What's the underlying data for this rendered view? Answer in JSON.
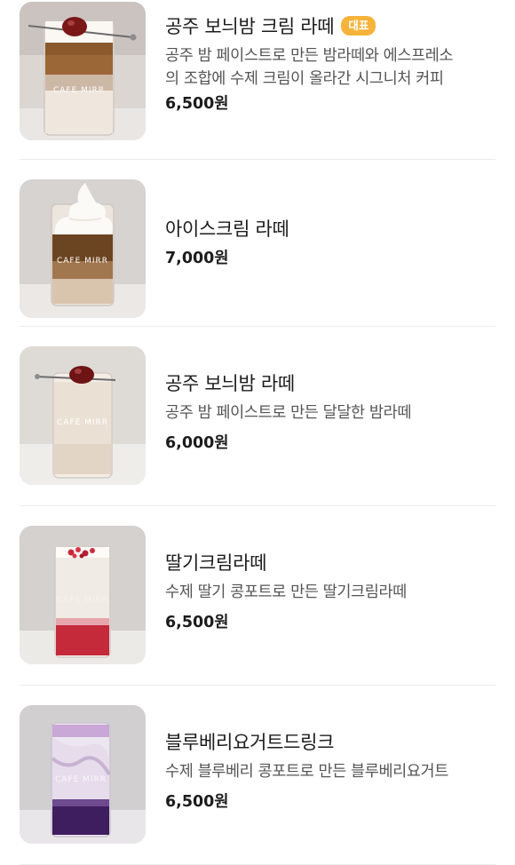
{
  "menu": {
    "items": [
      {
        "name": "공주 보늬밤 크림 라떼",
        "badge": "대표",
        "description_lines": [
          "공주 밤 페이스트로 만든 밤라떼와 에스프레소",
          "의 조합에 수제 크림이 올라간 시그니처 커피"
        ],
        "price": "6,500원",
        "image_icon": "chestnut-cream-latte-photo"
      },
      {
        "name": "아이스크림 라떼",
        "badge": "",
        "description_lines": [],
        "price": "7,000원",
        "image_icon": "icecream-latte-photo"
      },
      {
        "name": "공주 보늬밤 라떼",
        "badge": "",
        "description_lines": [
          "공주 밤 페이스트로 만든 달달한 밤라떼"
        ],
        "price": "6,000원",
        "image_icon": "chestnut-latte-photo"
      },
      {
        "name": "딸기크림라떼",
        "badge": "",
        "description_lines": [
          "수제 딸기 콩포트로 만든 딸기크림라떼"
        ],
        "price": "6,500원",
        "image_icon": "strawberry-cream-latte-photo"
      },
      {
        "name": "블루베리요거트드링크",
        "badge": "",
        "description_lines": [
          "수제 블루베리 콩포트로 만든 블루베리요거트"
        ],
        "price": "6,500원",
        "image_icon": "blueberry-yogurt-drink-photo"
      }
    ],
    "glass_print": "CAFE MIRR",
    "colors": {
      "badge": "#f6b33b",
      "divider": "#ececec",
      "description": "#555555"
    }
  }
}
